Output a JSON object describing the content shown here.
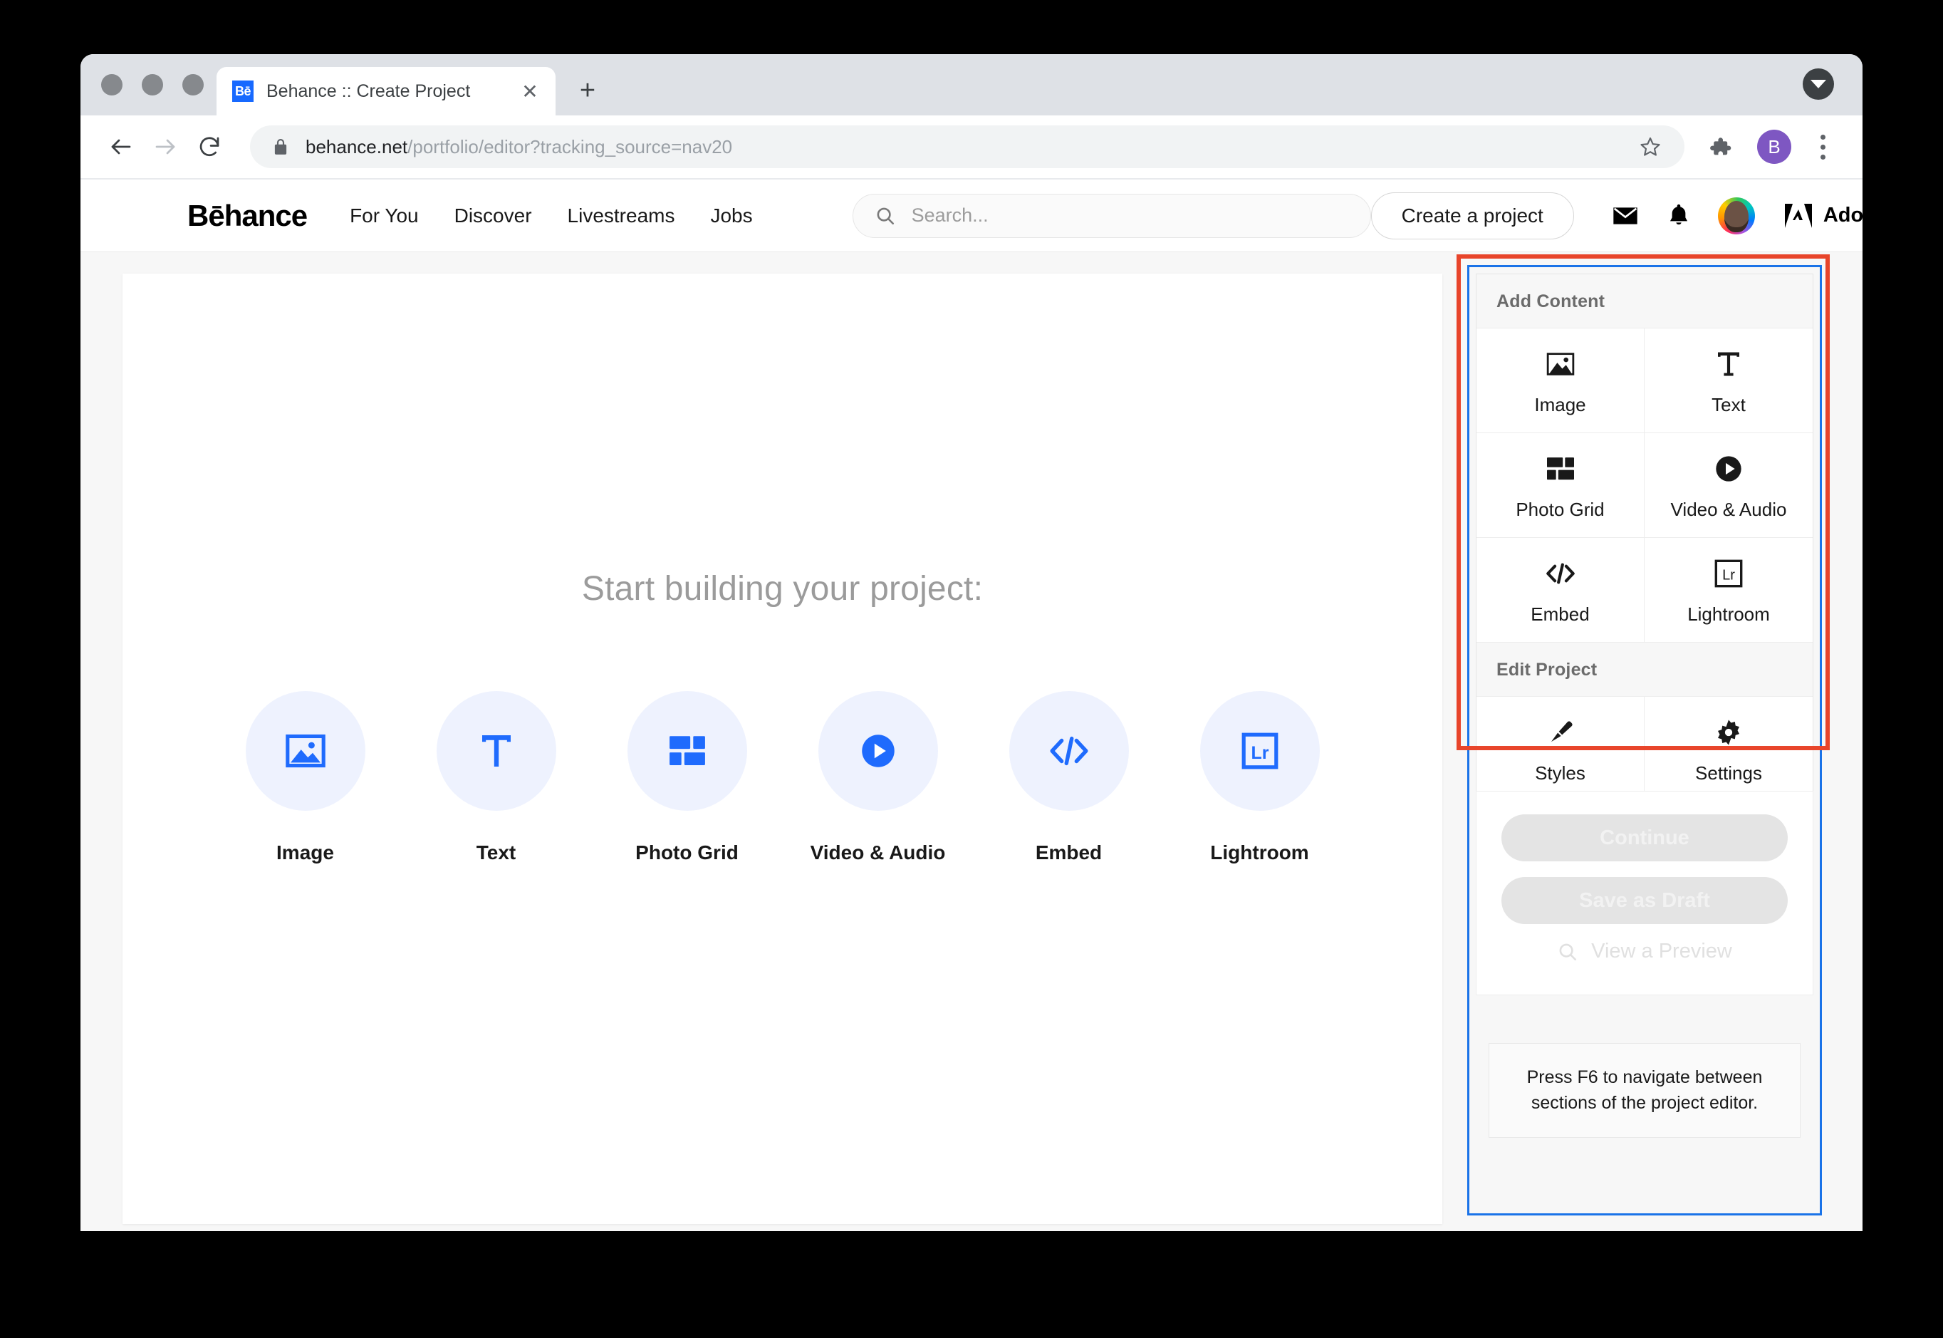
{
  "browser": {
    "tab": {
      "favicon_text": "Bē",
      "title": "Behance :: Create Project",
      "close_label": "✕"
    },
    "new_tab_label": "+",
    "toolbar": {
      "back_icon": "back-arrow-icon",
      "forward_icon": "forward-arrow-icon",
      "reload_icon": "reload-icon",
      "lock_icon": "lock-icon",
      "url_domain": "behance.net",
      "url_path": "/portfolio/editor?tracking_source=nav20",
      "star_icon": "bookmark-star-icon",
      "extensions_icon": "puzzle-piece-icon",
      "profile_initial": "B",
      "menu_icon": "three-dot-menu-icon"
    }
  },
  "behance": {
    "logo": "Bēhance",
    "nav": [
      {
        "label": "For You"
      },
      {
        "label": "Discover"
      },
      {
        "label": "Livestreams"
      },
      {
        "label": "Jobs"
      }
    ],
    "search_placeholder": "Search...",
    "create_project_label": "Create a project",
    "icons": {
      "mail": "envelope-icon",
      "notifications": "bell-icon",
      "avatar": "user-avatar"
    },
    "adobe_label": "Adobe"
  },
  "canvas": {
    "heading": "Start building your project:",
    "options": [
      {
        "label": "Image",
        "icon": "image-icon"
      },
      {
        "label": "Text",
        "icon": "text-t-icon"
      },
      {
        "label": "Photo Grid",
        "icon": "photo-grid-icon"
      },
      {
        "label": "Video & Audio",
        "icon": "play-circle-icon"
      },
      {
        "label": "Embed",
        "icon": "code-brackets-icon"
      },
      {
        "label": "Lightroom",
        "icon": "lightroom-lr-icon"
      }
    ]
  },
  "sidebar": {
    "add_content": {
      "header": "Add Content",
      "items": [
        {
          "label": "Image",
          "icon": "image-icon"
        },
        {
          "label": "Text",
          "icon": "text-t-icon"
        },
        {
          "label": "Photo Grid",
          "icon": "photo-grid-icon"
        },
        {
          "label": "Video & Audio",
          "icon": "play-circle-icon"
        },
        {
          "label": "Embed",
          "icon": "code-brackets-icon"
        },
        {
          "label": "Lightroom",
          "icon": "lightroom-lr-icon"
        }
      ]
    },
    "edit_project": {
      "header": "Edit Project",
      "items": [
        {
          "label": "Styles",
          "icon": "paintbrush-icon"
        },
        {
          "label": "Settings",
          "icon": "gear-icon"
        }
      ]
    },
    "actions": {
      "continue_label": "Continue",
      "save_draft_label": "Save as Draft",
      "preview_label": "View a Preview",
      "preview_icon": "magnifier-icon"
    },
    "tip": "Press F6 to navigate between sections of the project editor."
  },
  "annotations": {
    "highlight_color": "#e8452b",
    "focus_ring_color": "#1a73e8"
  }
}
